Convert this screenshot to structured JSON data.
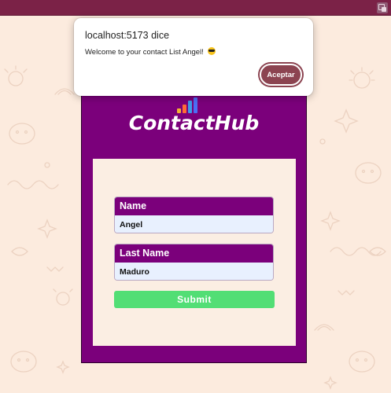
{
  "dialog": {
    "title": "localhost:5173 dice",
    "message": "Welcome to your contact List Angel!",
    "emoji": "smiling-face-with-sunglasses",
    "button_label": "Aceptar"
  },
  "app": {
    "brand": "ContactHub",
    "logo_colors": [
      "#f2b134",
      "#ff6b35",
      "#3d9be9",
      "#4c6ef5"
    ]
  },
  "form": {
    "fields": [
      {
        "label": "Name",
        "value": "Angel"
      },
      {
        "label": "Last Name",
        "value": "Maduro"
      }
    ],
    "submit_label": "Submit"
  },
  "colors": {
    "card": "#7b007b",
    "submit": "#52de75",
    "dialog_button": "#8c4451",
    "topbar": "#7b2247"
  }
}
